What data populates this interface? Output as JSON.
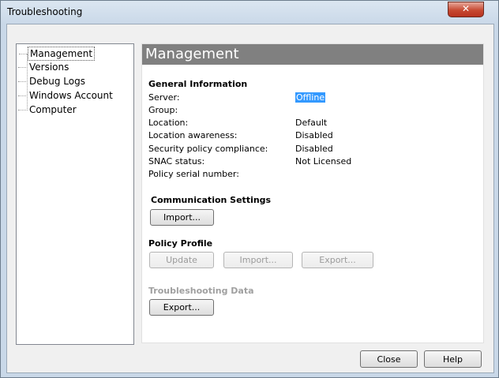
{
  "window": {
    "title": "Troubleshooting",
    "close_glyph": "✕"
  },
  "tree": {
    "items": [
      {
        "label": "Management",
        "selected": true
      },
      {
        "label": "Versions"
      },
      {
        "label": "Debug Logs"
      },
      {
        "label": "Windows Account"
      },
      {
        "label": "Computer"
      }
    ]
  },
  "panel": {
    "header": "Management",
    "general": {
      "heading": "General Information",
      "rows": [
        {
          "label": "Server:",
          "value": "Offline"
        },
        {
          "label": "Group:",
          "value": ""
        },
        {
          "label": "Location:",
          "value": "Default"
        },
        {
          "label": "Location awareness:",
          "value": "Disabled"
        },
        {
          "label": "Security policy compliance:",
          "value": "Disabled"
        },
        {
          "label": "SNAC status:",
          "value": "Not Licensed"
        },
        {
          "label": "Policy serial number:",
          "value": ""
        }
      ]
    },
    "communication": {
      "heading": "Communication Settings",
      "import_label": "Import..."
    },
    "policy": {
      "heading": "Policy Profile",
      "update_label": "Update",
      "import_label": "Import...",
      "export_label": "Export..."
    },
    "troubleshooting": {
      "heading": "Troubleshooting Data",
      "export_label": "Export..."
    }
  },
  "footer": {
    "close_label": "Close",
    "help_label": "Help"
  },
  "colors": {
    "header_bg": "#808080",
    "selection": "#3399ff"
  }
}
